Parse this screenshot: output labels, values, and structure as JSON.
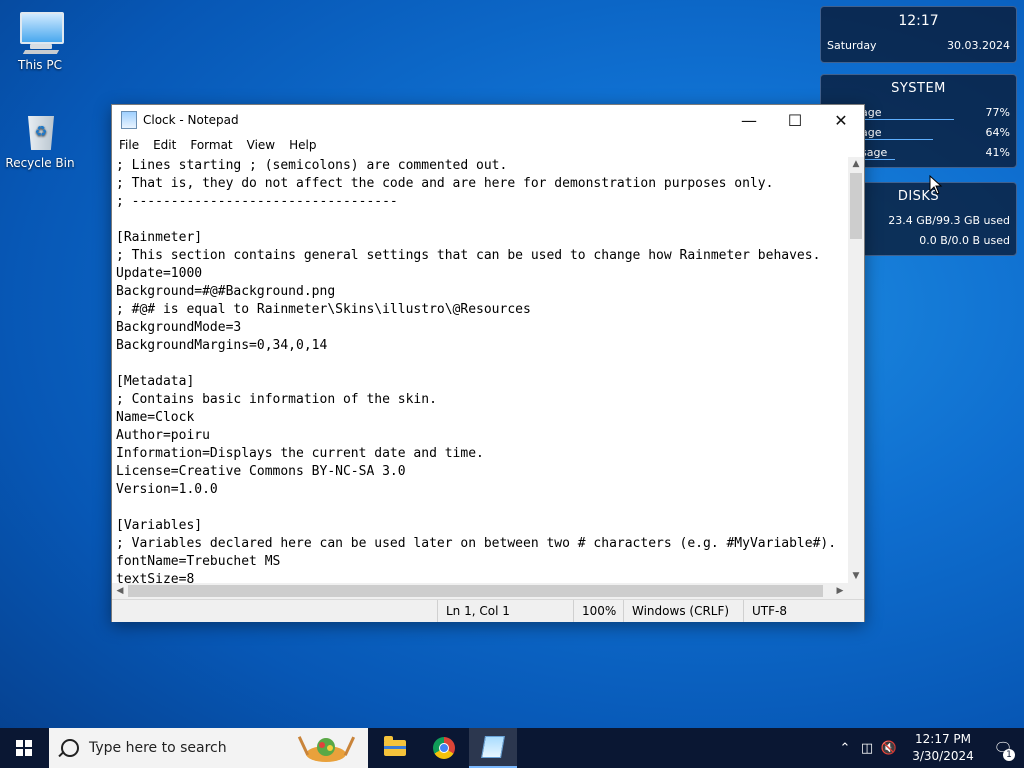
{
  "desktop": {
    "icons": [
      {
        "label": "This PC"
      },
      {
        "label": "Recycle Bin"
      }
    ]
  },
  "widgets": {
    "clock": {
      "time": "12:17",
      "day": "Saturday",
      "date": "30.03.2024"
    },
    "system": {
      "title": "SYSTEM",
      "rows": [
        {
          "label": "age",
          "value": "77%",
          "fill": 0.77
        },
        {
          "label": "age",
          "value": "64%",
          "fill": 0.64
        },
        {
          "label": "sage",
          "value": "41%",
          "fill": 0.41
        }
      ]
    },
    "disks": {
      "title": "DISKS",
      "rows": [
        {
          "value": "23.4 GB/99.3 GB used"
        },
        {
          "value": "0.0 B/0.0 B used"
        }
      ]
    }
  },
  "notepad": {
    "title": "Clock - Notepad",
    "menu": [
      "File",
      "Edit",
      "Format",
      "View",
      "Help"
    ],
    "content": "; Lines starting ; (semicolons) are commented out.\n; That is, they do not affect the code and are here for demonstration purposes only.\n; ----------------------------------\n\n[Rainmeter]\n; This section contains general settings that can be used to change how Rainmeter behaves.\nUpdate=1000\nBackground=#@#Background.png\n; #@# is equal to Rainmeter\\Skins\\illustro\\@Resources\nBackgroundMode=3\nBackgroundMargins=0,34,0,14\n\n[Metadata]\n; Contains basic information of the skin.\nName=Clock\nAuthor=poiru\nInformation=Displays the current date and time.\nLicense=Creative Commons BY-NC-SA 3.0\nVersion=1.0.0\n\n[Variables]\n; Variables declared here can be used later on between two # characters (e.g. #MyVariable#).\nfontName=Trebuchet MS\ntextSize=8",
    "status": {
      "position": "Ln 1, Col 1",
      "zoom": "100%",
      "line_ending": "Windows (CRLF)",
      "encoding": "UTF-8"
    }
  },
  "taskbar": {
    "search_placeholder": "Type here to search",
    "time": "12:17 PM",
    "date": "3/30/2024",
    "notification_count": "1"
  }
}
